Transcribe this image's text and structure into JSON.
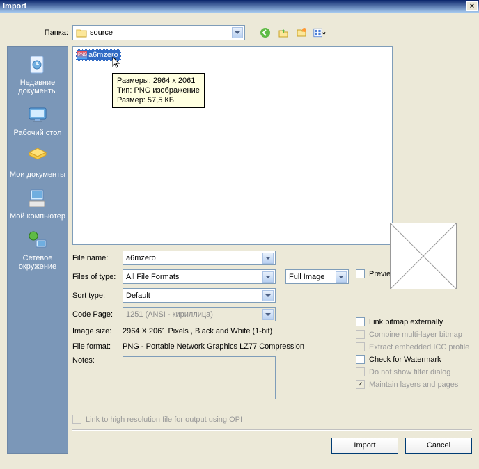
{
  "title": "Import",
  "folder": {
    "label": "Папка:",
    "value": "source"
  },
  "tooltip": {
    "line1": "Размеры: 2964 x 2061",
    "line2": "Тип: PNG изображение",
    "line3": "Размер: 57,5 КБ"
  },
  "file": {
    "name": "a6mzero"
  },
  "sidebar": {
    "recent": "Недавние документы",
    "desktop": "Рабочий стол",
    "mydocs": "Мои документы",
    "mycomp": "Мой компьютер",
    "network": "Сетевое окружение"
  },
  "labels": {
    "filename": "File name:",
    "filetype": "Files of type:",
    "sorttype": "Sort type:",
    "codepage": "Code Page:",
    "imagesize": "Image size:",
    "fileformat": "File format:",
    "notes": "Notes:",
    "preview": "Preview"
  },
  "values": {
    "filename": "a6mzero",
    "filetype": "All File Formats",
    "sorttype": "Default",
    "codepage": "1251  (ANSI - кириллица)",
    "fullimage": "Full Image",
    "imagesize": "2964 X 2061 Pixels , Black and White (1-bit)",
    "fileformat": "PNG - Portable Network Graphics LZ77 Compression"
  },
  "checks": {
    "link_ext": "Link bitmap externally",
    "combine": "Combine multi-layer bitmap",
    "extract_icc": "Extract embedded ICC profile",
    "watermark": "Check for Watermark",
    "no_filter": "Do not show filter dialog",
    "maintain": "Maintain layers and pages",
    "opi": "Link to high resolution file for output using OPI"
  },
  "buttons": {
    "import": "Import",
    "cancel": "Cancel"
  }
}
